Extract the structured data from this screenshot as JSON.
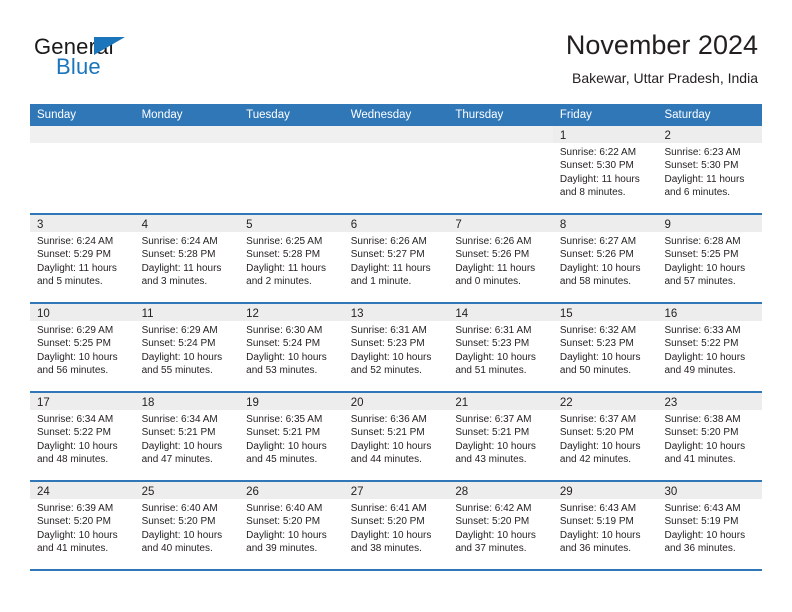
{
  "logo": {
    "word_general": "General",
    "word_blue": "Blue",
    "triangle_color": "#1b75bb"
  },
  "header": {
    "title": "November 2024",
    "subtitle": "Bakewar, Uttar Pradesh, India"
  },
  "theme": {
    "header_blue": "#3077b8",
    "daynum_band": "#ededed",
    "text": "#231f20"
  },
  "weekdays": [
    "Sunday",
    "Monday",
    "Tuesday",
    "Wednesday",
    "Thursday",
    "Friday",
    "Saturday"
  ],
  "weeks": [
    [
      {
        "day": "",
        "lines": []
      },
      {
        "day": "",
        "lines": []
      },
      {
        "day": "",
        "lines": []
      },
      {
        "day": "",
        "lines": []
      },
      {
        "day": "",
        "lines": []
      },
      {
        "day": "1",
        "lines": [
          "Sunrise: 6:22 AM",
          "Sunset: 5:30 PM",
          "Daylight: 11 hours",
          "and 8 minutes."
        ]
      },
      {
        "day": "2",
        "lines": [
          "Sunrise: 6:23 AM",
          "Sunset: 5:30 PM",
          "Daylight: 11 hours",
          "and 6 minutes."
        ]
      }
    ],
    [
      {
        "day": "3",
        "lines": [
          "Sunrise: 6:24 AM",
          "Sunset: 5:29 PM",
          "Daylight: 11 hours",
          "and 5 minutes."
        ]
      },
      {
        "day": "4",
        "lines": [
          "Sunrise: 6:24 AM",
          "Sunset: 5:28 PM",
          "Daylight: 11 hours",
          "and 3 minutes."
        ]
      },
      {
        "day": "5",
        "lines": [
          "Sunrise: 6:25 AM",
          "Sunset: 5:28 PM",
          "Daylight: 11 hours",
          "and 2 minutes."
        ]
      },
      {
        "day": "6",
        "lines": [
          "Sunrise: 6:26 AM",
          "Sunset: 5:27 PM",
          "Daylight: 11 hours",
          "and 1 minute."
        ]
      },
      {
        "day": "7",
        "lines": [
          "Sunrise: 6:26 AM",
          "Sunset: 5:26 PM",
          "Daylight: 11 hours",
          "and 0 minutes."
        ]
      },
      {
        "day": "8",
        "lines": [
          "Sunrise: 6:27 AM",
          "Sunset: 5:26 PM",
          "Daylight: 10 hours",
          "and 58 minutes."
        ]
      },
      {
        "day": "9",
        "lines": [
          "Sunrise: 6:28 AM",
          "Sunset: 5:25 PM",
          "Daylight: 10 hours",
          "and 57 minutes."
        ]
      }
    ],
    [
      {
        "day": "10",
        "lines": [
          "Sunrise: 6:29 AM",
          "Sunset: 5:25 PM",
          "Daylight: 10 hours",
          "and 56 minutes."
        ]
      },
      {
        "day": "11",
        "lines": [
          "Sunrise: 6:29 AM",
          "Sunset: 5:24 PM",
          "Daylight: 10 hours",
          "and 55 minutes."
        ]
      },
      {
        "day": "12",
        "lines": [
          "Sunrise: 6:30 AM",
          "Sunset: 5:24 PM",
          "Daylight: 10 hours",
          "and 53 minutes."
        ]
      },
      {
        "day": "13",
        "lines": [
          "Sunrise: 6:31 AM",
          "Sunset: 5:23 PM",
          "Daylight: 10 hours",
          "and 52 minutes."
        ]
      },
      {
        "day": "14",
        "lines": [
          "Sunrise: 6:31 AM",
          "Sunset: 5:23 PM",
          "Daylight: 10 hours",
          "and 51 minutes."
        ]
      },
      {
        "day": "15",
        "lines": [
          "Sunrise: 6:32 AM",
          "Sunset: 5:23 PM",
          "Daylight: 10 hours",
          "and 50 minutes."
        ]
      },
      {
        "day": "16",
        "lines": [
          "Sunrise: 6:33 AM",
          "Sunset: 5:22 PM",
          "Daylight: 10 hours",
          "and 49 minutes."
        ]
      }
    ],
    [
      {
        "day": "17",
        "lines": [
          "Sunrise: 6:34 AM",
          "Sunset: 5:22 PM",
          "Daylight: 10 hours",
          "and 48 minutes."
        ]
      },
      {
        "day": "18",
        "lines": [
          "Sunrise: 6:34 AM",
          "Sunset: 5:21 PM",
          "Daylight: 10 hours",
          "and 47 minutes."
        ]
      },
      {
        "day": "19",
        "lines": [
          "Sunrise: 6:35 AM",
          "Sunset: 5:21 PM",
          "Daylight: 10 hours",
          "and 45 minutes."
        ]
      },
      {
        "day": "20",
        "lines": [
          "Sunrise: 6:36 AM",
          "Sunset: 5:21 PM",
          "Daylight: 10 hours",
          "and 44 minutes."
        ]
      },
      {
        "day": "21",
        "lines": [
          "Sunrise: 6:37 AM",
          "Sunset: 5:21 PM",
          "Daylight: 10 hours",
          "and 43 minutes."
        ]
      },
      {
        "day": "22",
        "lines": [
          "Sunrise: 6:37 AM",
          "Sunset: 5:20 PM",
          "Daylight: 10 hours",
          "and 42 minutes."
        ]
      },
      {
        "day": "23",
        "lines": [
          "Sunrise: 6:38 AM",
          "Sunset: 5:20 PM",
          "Daylight: 10 hours",
          "and 41 minutes."
        ]
      }
    ],
    [
      {
        "day": "24",
        "lines": [
          "Sunrise: 6:39 AM",
          "Sunset: 5:20 PM",
          "Daylight: 10 hours",
          "and 41 minutes."
        ]
      },
      {
        "day": "25",
        "lines": [
          "Sunrise: 6:40 AM",
          "Sunset: 5:20 PM",
          "Daylight: 10 hours",
          "and 40 minutes."
        ]
      },
      {
        "day": "26",
        "lines": [
          "Sunrise: 6:40 AM",
          "Sunset: 5:20 PM",
          "Daylight: 10 hours",
          "and 39 minutes."
        ]
      },
      {
        "day": "27",
        "lines": [
          "Sunrise: 6:41 AM",
          "Sunset: 5:20 PM",
          "Daylight: 10 hours",
          "and 38 minutes."
        ]
      },
      {
        "day": "28",
        "lines": [
          "Sunrise: 6:42 AM",
          "Sunset: 5:20 PM",
          "Daylight: 10 hours",
          "and 37 minutes."
        ]
      },
      {
        "day": "29",
        "lines": [
          "Sunrise: 6:43 AM",
          "Sunset: 5:19 PM",
          "Daylight: 10 hours",
          "and 36 minutes."
        ]
      },
      {
        "day": "30",
        "lines": [
          "Sunrise: 6:43 AM",
          "Sunset: 5:19 PM",
          "Daylight: 10 hours",
          "and 36 minutes."
        ]
      }
    ]
  ]
}
